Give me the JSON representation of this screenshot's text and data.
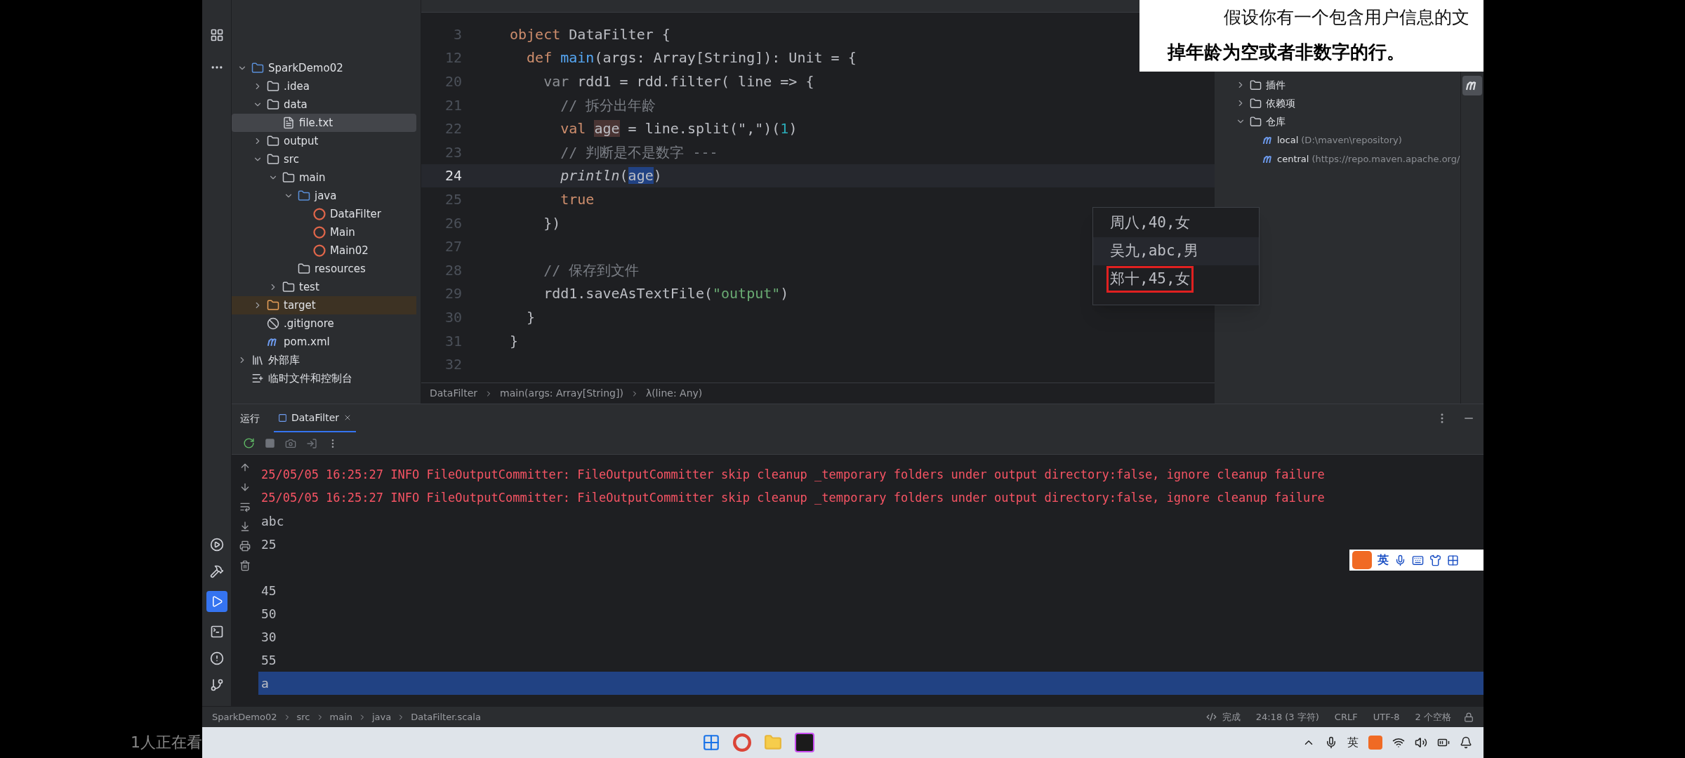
{
  "project_tree": [
    {
      "label": "SparkDemo02",
      "kind": "project",
      "expanded": true,
      "selected": false,
      "children": [
        {
          "label": ".idea",
          "kind": "folder",
          "expanded": false,
          "selected": false
        },
        {
          "label": "data",
          "kind": "folder",
          "expanded": true,
          "selected": false,
          "children": [
            {
              "label": "file.txt",
              "kind": "text-file",
              "selected": true
            }
          ]
        },
        {
          "label": "output",
          "kind": "folder",
          "expanded": false,
          "selected": false
        },
        {
          "label": "src",
          "kind": "folder",
          "expanded": true,
          "selected": false,
          "children": [
            {
              "label": "main",
              "kind": "folder",
              "expanded": true,
              "selected": false,
              "children": [
                {
                  "label": "java",
                  "kind": "source-folder",
                  "expanded": true,
                  "selected": false,
                  "children": [
                    {
                      "label": "DataFilter",
                      "kind": "scala-object",
                      "selected": false
                    },
                    {
                      "label": "Main",
                      "kind": "scala-object",
                      "selected": false
                    },
                    {
                      "label": "Main02",
                      "kind": "scala-object",
                      "selected": false
                    }
                  ]
                },
                {
                  "label": "resources",
                  "kind": "resources-folder",
                  "selected": false
                }
              ]
            },
            {
              "label": "test",
              "kind": "folder",
              "expanded": false,
              "selected": false
            }
          ]
        },
        {
          "label": "target",
          "kind": "excluded-folder",
          "expanded": false,
          "selected": false
        },
        {
          "label": ".gitignore",
          "kind": "ignore-file",
          "selected": false
        },
        {
          "label": "pom.xml",
          "kind": "maven-file",
          "selected": false
        }
      ]
    },
    {
      "label": "外部库",
      "kind": "library",
      "expanded": false,
      "selected": false
    },
    {
      "label": "临时文件和控制台",
      "kind": "scratches",
      "selected": false
    }
  ],
  "editor": {
    "lines": [
      {
        "number": "3",
        "current": false,
        "segments": [
          {
            "text": "object ",
            "kind": "keyword"
          },
          {
            "text": "DataFilter {",
            "kind": "plain"
          }
        ]
      },
      {
        "number": "12",
        "current": false,
        "segments": [
          {
            "text": "  def ",
            "kind": "keyword"
          },
          {
            "text": "main",
            "kind": "function"
          },
          {
            "text": "(args: Array[String]): Unit = {",
            "kind": "plain"
          }
        ]
      },
      {
        "number": "20",
        "current": false,
        "segments": [
          {
            "text": "    var ",
            "kind": "muted"
          },
          {
            "text": "rdd1 = rdd.filter( line => {",
            "kind": "plain"
          }
        ]
      },
      {
        "number": "21",
        "current": false,
        "segments": [
          {
            "text": "      // 拆分出年龄",
            "kind": "comment"
          }
        ]
      },
      {
        "number": "22",
        "current": false,
        "segments": [
          {
            "text": "      val ",
            "kind": "keyword"
          },
          {
            "text": "age",
            "kind": "usage"
          },
          {
            "text": " = line.split(\",\")(",
            "kind": "plain"
          },
          {
            "text": "1",
            "kind": "number"
          },
          {
            "text": ")",
            "kind": "plain"
          }
        ]
      },
      {
        "number": "23",
        "current": false,
        "segments": [
          {
            "text": "      // 判断是不是数字 ---",
            "kind": "comment"
          }
        ]
      },
      {
        "number": "24",
        "current": true,
        "segments": [
          {
            "text": "      println",
            "kind": "italic"
          },
          {
            "text": "(",
            "kind": "plain"
          },
          {
            "text": "age",
            "kind": "selection"
          },
          {
            "text": ")",
            "kind": "plain"
          }
        ]
      },
      {
        "number": "25",
        "current": false,
        "segments": [
          {
            "text": "      true",
            "kind": "keyword"
          }
        ]
      },
      {
        "number": "26",
        "current": false,
        "segments": [
          {
            "text": "    })",
            "kind": "plain"
          }
        ]
      },
      {
        "number": "27",
        "current": false
      },
      {
        "number": "28",
        "current": false,
        "segments": [
          {
            "text": "    // 保存到文件",
            "kind": "comment"
          }
        ]
      },
      {
        "number": "29",
        "current": false,
        "segments": [
          {
            "text": "    rdd1.saveAsTextFile(",
            "kind": "plain"
          },
          {
            "text": "\"output\"",
            "kind": "string"
          },
          {
            "text": ")",
            "kind": "plain"
          }
        ]
      },
      {
        "number": "30",
        "current": false,
        "segments": [
          {
            "text": "  }",
            "kind": "plain"
          }
        ]
      },
      {
        "number": "31",
        "current": false,
        "segments": [
          {
            "text": "}",
            "kind": "plain"
          }
        ]
      },
      {
        "number": "32",
        "current": false
      }
    ],
    "breadcrumbs": [
      "DataFilter",
      "main(args: Array[String])",
      "λ(line: Any)"
    ]
  },
  "file_preview": [
    {
      "text": "周八,40,女",
      "current": false,
      "boxed": false
    },
    {
      "text": "吴九,abc,男",
      "current": true,
      "boxed": false
    },
    {
      "text": "郑十,45,女",
      "current": false,
      "boxed": true
    }
  ],
  "maven_tree": [
    {
      "label": "插件",
      "expanded": false
    },
    {
      "label": "依赖项",
      "expanded": false
    },
    {
      "label": "仓库",
      "expanded": true,
      "children": [
        {
          "label": "local",
          "detail": "(D:\\maven\\repository)"
        },
        {
          "label": "central",
          "detail": "(https://repo.maven.apache.org/"
        }
      ]
    }
  ],
  "caption": [
    "假设你有一个包含用户信息的文",
    "掉年龄为空或者非数字的行。"
  ],
  "run_panel": {
    "title": "运行",
    "tabs": [
      {
        "label": "DataFilter",
        "selected": true
      }
    ],
    "console": [
      {
        "kind": "log",
        "text": "25/05/05 16:25:27 INFO FileOutputCommitter: FileOutputCommitter skip cleanup _temporary folders under output directory:false, ignore cleanup failure",
        "selected": false
      },
      {
        "kind": "log",
        "text": "25/05/05 16:25:27 INFO FileOutputCommitter: FileOutputCommitter skip cleanup _temporary folders under output directory:false, ignore cleanup failure",
        "selected": false
      },
      {
        "kind": "output",
        "text": "abc",
        "selected": false
      },
      {
        "kind": "output",
        "text": "25",
        "selected": false
      },
      {
        "kind": "blank",
        "selected": false
      },
      {
        "kind": "output",
        "text": "45",
        "selected": false
      },
      {
        "kind": "output",
        "text": "50",
        "selected": false
      },
      {
        "kind": "output",
        "text": "30",
        "selected": false
      },
      {
        "kind": "output",
        "text": "55",
        "selected": false
      },
      {
        "kind": "output",
        "text": "a",
        "selected": true
      }
    ]
  },
  "ime_bar": {
    "mode": "英"
  },
  "status_bar": {
    "path": [
      "SparkDemo02",
      "src",
      "main",
      "java",
      "DataFilter.scala"
    ],
    "status": "完成",
    "position": "24:18 (3 字符)",
    "line_ending": "CRLF",
    "encoding": "UTF-8",
    "indent": "2 个空格"
  },
  "taskbar": {
    "ime": "英"
  },
  "viewers": "1人正在看"
}
